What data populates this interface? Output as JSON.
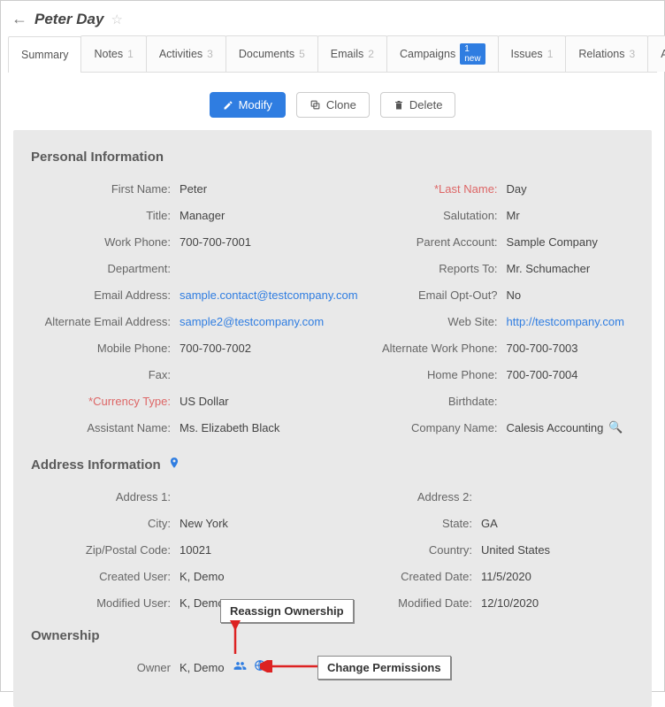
{
  "header": {
    "title": "Peter Day"
  },
  "tabs": [
    {
      "label": "Summary",
      "count": null
    },
    {
      "label": "Notes",
      "count": "1"
    },
    {
      "label": "Activities",
      "count": "3"
    },
    {
      "label": "Documents",
      "count": "5"
    },
    {
      "label": "Emails",
      "count": "2"
    },
    {
      "label": "Campaigns",
      "badge": "1 new"
    },
    {
      "label": "Issues",
      "count": "1"
    },
    {
      "label": "Relations",
      "count": "3"
    },
    {
      "label": "All",
      "count": null
    }
  ],
  "actions": {
    "modify": "Modify",
    "clone": "Clone",
    "delete": "Delete"
  },
  "sections": {
    "personal": "Personal Information",
    "address": "Address Information",
    "ownership": "Ownership"
  },
  "fields": {
    "first_name": {
      "label": "First Name:",
      "value": "Peter"
    },
    "last_name": {
      "label": "*Last Name:",
      "value": "Day"
    },
    "title": {
      "label": "Title:",
      "value": "Manager"
    },
    "salutation": {
      "label": "Salutation:",
      "value": "Mr"
    },
    "work_phone": {
      "label": "Work Phone:",
      "value": "700-700-7001"
    },
    "parent_account": {
      "label": "Parent Account:",
      "value": "Sample Company"
    },
    "department": {
      "label": "Department:",
      "value": ""
    },
    "reports_to": {
      "label": "Reports To:",
      "value": "Mr. Schumacher"
    },
    "email": {
      "label": "Email Address:",
      "value": "sample.contact@testcompany.com"
    },
    "email_optout": {
      "label": "Email Opt-Out?",
      "value": "No"
    },
    "alt_email": {
      "label": "Alternate Email Address:",
      "value": "sample2@testcompany.com"
    },
    "website": {
      "label": "Web Site:",
      "value": "http://testcompany.com"
    },
    "mobile": {
      "label": "Mobile Phone:",
      "value": "700-700-7002"
    },
    "alt_work": {
      "label": "Alternate Work Phone:",
      "value": "700-700-7003"
    },
    "fax": {
      "label": "Fax:",
      "value": ""
    },
    "home_phone": {
      "label": "Home Phone:",
      "value": "700-700-7004"
    },
    "currency": {
      "label": "*Currency Type:",
      "value": "US Dollar"
    },
    "birthdate": {
      "label": "Birthdate:",
      "value": ""
    },
    "assistant": {
      "label": "Assistant Name:",
      "value": "Ms. Elizabeth Black"
    },
    "company": {
      "label": "Company Name:",
      "value": "Calesis Accounting"
    },
    "address1": {
      "label": "Address 1:",
      "value": ""
    },
    "address2": {
      "label": "Address 2:",
      "value": ""
    },
    "city": {
      "label": "City:",
      "value": "New York"
    },
    "state": {
      "label": "State:",
      "value": "GA"
    },
    "zip": {
      "label": "Zip/Postal Code:",
      "value": "10021"
    },
    "country": {
      "label": "Country:",
      "value": "United States"
    },
    "created_user": {
      "label": "Created User:",
      "value": "K, Demo"
    },
    "created_date": {
      "label": "Created Date:",
      "value": "11/5/2020"
    },
    "modified_user": {
      "label": "Modified User:",
      "value": "K, Demo"
    },
    "modified_date": {
      "label": "Modified Date:",
      "value": "12/10/2020"
    },
    "owner": {
      "label": "Owner",
      "value": "K, Demo"
    }
  },
  "callouts": {
    "reassign": "Reassign Ownership",
    "permissions": "Change Permissions"
  }
}
